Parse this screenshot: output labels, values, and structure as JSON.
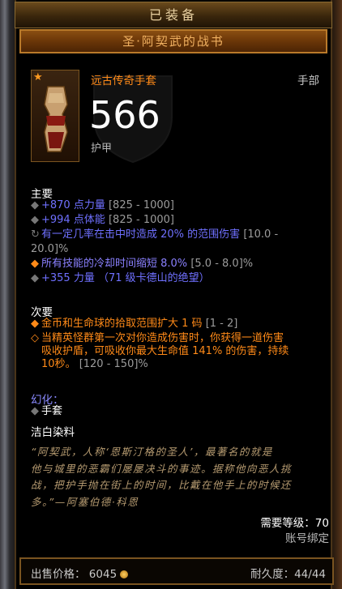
{
  "status": "已装备",
  "item_name": "圣·阿契武的战书",
  "item_type": "远古传奇手套",
  "slot": "手部",
  "armor_value": "566",
  "armor_label": "护甲",
  "primary": {
    "heading": "主要",
    "stats": [
      {
        "text": "+870 点力量",
        "range": "[825 - 1000]"
      },
      {
        "text": "+994 点体能",
        "range": "[825 - 1000]"
      },
      {
        "text": "有一定几率在击中时造成 20% 的范围伤害",
        "range": "[10.0 -"
      },
      {
        "text": "",
        "range": "20.0]%"
      },
      {
        "text": "所有技能的冷却时间缩短 8.0%",
        "range": "[5.0 - 8.0]%"
      },
      {
        "text": "+355 力量 （71 级卡德山的绝望）",
        "range": ""
      }
    ]
  },
  "secondary": {
    "heading": "次要",
    "stats": [
      {
        "text": "金币和生命球的拾取范围扩大 1 码",
        "range": "[1 - 2]"
      },
      {
        "text": "当精英怪群第一次对你造成伤害时，你获得一道伤害",
        "range": ""
      },
      {
        "text": "吸收护盾，可吸收你最大生命值 141% 的伤害，持续",
        "range": ""
      },
      {
        "text": "10秒。",
        "range": "[120 - 150]%"
      }
    ]
  },
  "transmog_label": "幻化：",
  "transmog_value": "手套",
  "dye": "洁白染料",
  "flavor": [
    "“阿契武，人称‘恩斯汀格的圣人’，最著名的就是",
    "他与城里的恶霸们屡屡决斗的事迹。据称他向恶人挑",
    "战，把护手抛在街上的时间，比戴在他手上的时候还",
    "多。”—阿塞伯德·科恩"
  ],
  "required_level": "需要等级：70",
  "account_bound": "账号绑定",
  "sell_label": "出售价格：",
  "sell_price": "6045",
  "durability": "耐久度：44/44",
  "colors": {
    "legendary": "#ff8a18",
    "magic": "#6f70ff",
    "gold_border": "#b97a2a"
  },
  "icons": [
    "ancient-star-icon",
    "gauntlet-icon",
    "gold-coin-icon",
    "bullet-diamond-icon"
  ]
}
